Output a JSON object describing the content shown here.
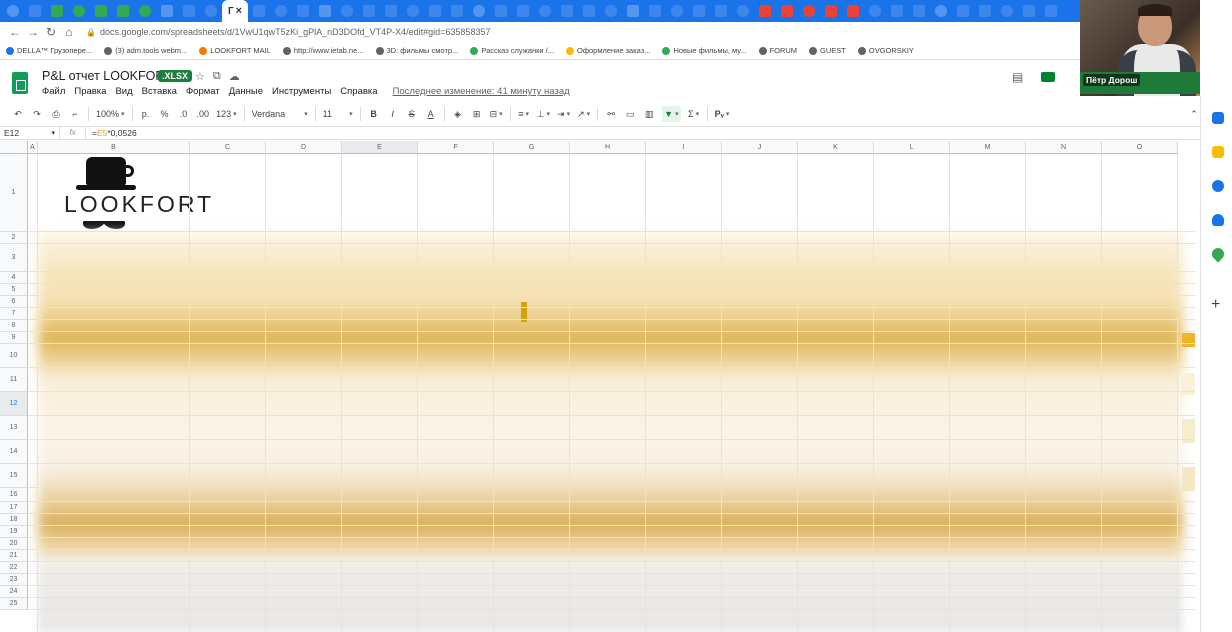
{
  "browser": {
    "active_tab_label": "Г",
    "url": "docs.google.com/spreadsheets/d/1VwU1qwT5zKi_gPlA_nD3DOfd_VT4P-X4/edit#gid=635858357"
  },
  "bookmarks": [
    {
      "label": "DELLA™ Грузопере..."
    },
    {
      "label": "(3) adm.tools webm..."
    },
    {
      "label": "LOOKFORT MAIL"
    },
    {
      "label": "http://www.ietab.ne..."
    },
    {
      "label": "3D: фильмы смотр..."
    },
    {
      "label": "Рассказ служанки /..."
    },
    {
      "label": "Оформление заказ..."
    },
    {
      "label": "Новые фильмы, му..."
    },
    {
      "label": "FORUM"
    },
    {
      "label": "GUEST"
    },
    {
      "label": "OVGORSKIY"
    }
  ],
  "doc": {
    "title": "P&L отчет LOOKFORT",
    "badge": ".XLSX",
    "last_edit": "Последнее изменение: 41 минуту назад"
  },
  "menu": [
    "Файл",
    "Правка",
    "Вид",
    "Вставка",
    "Формат",
    "Данные",
    "Инструменты",
    "Справка"
  ],
  "toolbar": {
    "zoom": "100%",
    "currency": "р.",
    "percent": "%",
    "dec_less": ".0",
    "dec_more": ".00",
    "format_more": "123",
    "font": "Verdana",
    "font_size": "11",
    "bold": "B",
    "italic": "I",
    "strike": "S",
    "text_color": "A",
    "functions": "Σ"
  },
  "formula_bar": {
    "cell": "E12",
    "fx": "fx",
    "formula_prefix": "=",
    "formula_ref": "E5",
    "formula_rest": "*0,0526"
  },
  "columns": [
    "A",
    "B",
    "C",
    "D",
    "E",
    "F",
    "G",
    "H",
    "I",
    "J",
    "K",
    "L",
    "M",
    "N",
    "O"
  ],
  "selected_column": "E",
  "rows": [
    "1",
    "2",
    "3",
    "4",
    "5",
    "6",
    "7",
    "8",
    "9",
    "10",
    "11",
    "12",
    "13",
    "14",
    "15",
    "16",
    "17",
    "18",
    "19",
    "20",
    "21",
    "22",
    "23",
    "24",
    "25"
  ],
  "selected_row": "12",
  "logo_text": "LOOKFORT",
  "video": {
    "participant_name": "Пётр Дорош"
  },
  "colors": {
    "tab_bar": "#1a73e8",
    "sheets_green": "#0f9d58",
    "xlsx_badge": "#188038",
    "highlight_gold": "#d4a10f"
  }
}
